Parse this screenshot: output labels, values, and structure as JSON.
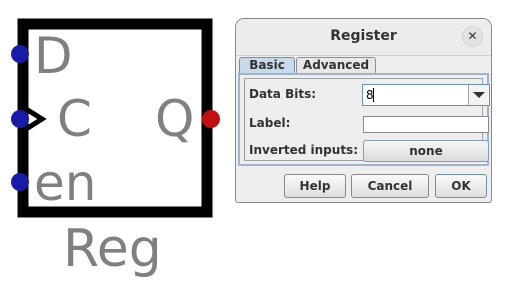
{
  "component": {
    "pins": {
      "d": "D",
      "c": "C",
      "q": "Q",
      "en": "en"
    },
    "name": "Reg",
    "colors": {
      "outline": "#000000",
      "input_pin": "#1a1aa8",
      "output_pin": "#c01010",
      "text": "#808080"
    }
  },
  "dialog": {
    "title": "Register",
    "close_icon": "close-icon",
    "tabs": [
      {
        "label": "Basic"
      },
      {
        "label": "Advanced"
      }
    ],
    "fields": {
      "data_bits": {
        "label": "Data Bits:",
        "value": "8"
      },
      "label": {
        "label": "Label:",
        "value": ""
      },
      "inverted_inputs": {
        "label": "Inverted inputs:",
        "value": "none"
      }
    },
    "buttons": {
      "help": "Help",
      "cancel": "Cancel",
      "ok": "OK"
    }
  }
}
